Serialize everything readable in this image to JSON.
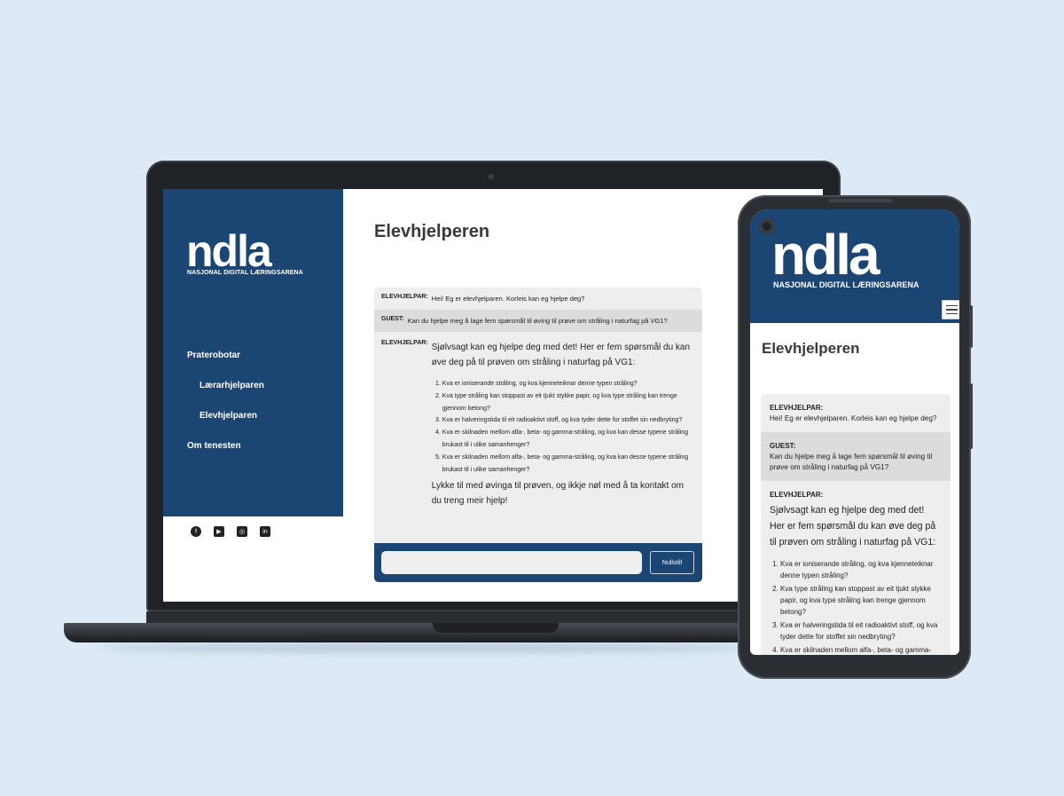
{
  "app": {
    "title": "Elevhjelperen",
    "logo": "ndla",
    "logo_subtitle": "NASJONAL DIGITAL LÆRINGSARENA"
  },
  "sidebar": {
    "items": [
      {
        "label": "Praterobotar"
      },
      {
        "label": "Lærarhjelparen"
      },
      {
        "label": "Elevhjelparen"
      },
      {
        "label": "Om tenesten"
      }
    ]
  },
  "social": {
    "icons": [
      "facebook-icon",
      "youtube-icon",
      "instagram-icon",
      "linkedin-icon"
    ],
    "glyphs": [
      "f",
      "▶",
      "◎",
      "in"
    ]
  },
  "chat": {
    "messages": [
      {
        "sender": "ELEVHJELPAR:",
        "text": "Hei! Eg er elevhjelparen. Korleis kan eg hjelpe deg?"
      },
      {
        "sender": "GUEST:",
        "text": "Kan du hjelpe meg å lage fem spørsmål til øving til prøve om stråling i naturfag på VG1?"
      },
      {
        "sender": "ELEVHJELPAR:",
        "intro": "Sjølvsagt kan eg hjelpe deg med det! Her er fem spørsmål du kan øve deg på til prøven om stråling i naturfag på VG1:",
        "list": [
          "Kva er ioniserande stråling, og kva kjenneteiknar denne typen stråling?",
          "Kva type stråling kan stoppast av eit tjukt stykke papir, og kva type stråling kan trenge gjennom betong?",
          "Kva er halveringstida til eit radioaktivt stoff, og kva tyder dette for stoffet sin nedbryting?",
          "Kva er skilnaden mellom alfa-, beta- og gamma-stråling, og kva kan desse typene stråling brukast til i ulike samanhenger?",
          "Kva er skilnaden mellom alfa-, beta- og gamma-stråling, og kva kan desse typene stråling brukast til i ulike samanhenger?"
        ],
        "outro": "Lykke til med øvinga til prøven, og ikkje nøl med å ta kontakt om du treng meir hjelp!"
      }
    ],
    "input_value": "",
    "reset_label": "Nullstill"
  },
  "colors": {
    "brand": "#1b4674",
    "background": "#ddeaf6",
    "chat_bg": "#eeeeee",
    "guest_bg": "#dcdcdc"
  }
}
